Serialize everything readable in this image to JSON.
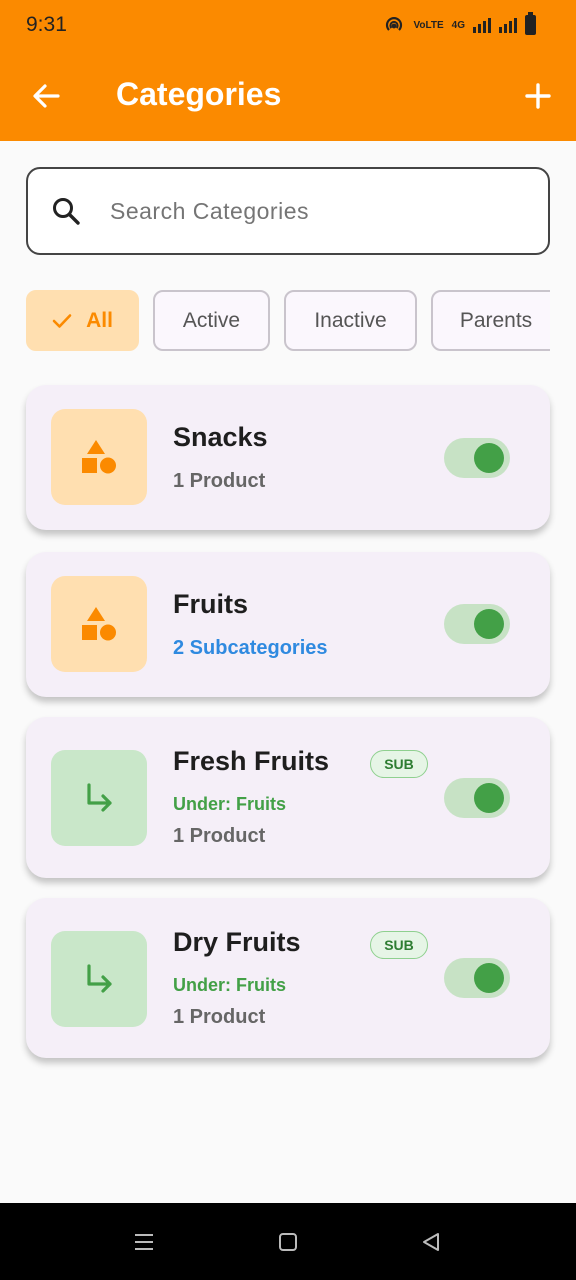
{
  "status_bar": {
    "time": "9:31",
    "network_label": "VoLTE",
    "network_sub": "4G"
  },
  "header": {
    "title": "Categories"
  },
  "search": {
    "placeholder": "Search Categories"
  },
  "filters": [
    {
      "label": "All",
      "selected": true
    },
    {
      "label": "Active",
      "selected": false
    },
    {
      "label": "Inactive",
      "selected": false
    },
    {
      "label": "Parents",
      "selected": false
    }
  ],
  "categories": [
    {
      "name": "Snacks",
      "detail": "1 Product",
      "active": true,
      "icon": "shapes-icon"
    },
    {
      "name": "Fruits",
      "detail": "2 Subcategories",
      "active": true,
      "icon": "shapes-icon"
    },
    {
      "name": "Fresh Fruits",
      "badge": "SUB",
      "parent": "Under: Fruits",
      "detail": "1 Product",
      "active": true,
      "icon": "subdirectory-arrow-icon"
    },
    {
      "name": "Dry Fruits",
      "badge": "SUB",
      "parent": "Under: Fruits",
      "detail": "1 Product",
      "active": true,
      "icon": "subdirectory-arrow-icon"
    }
  ],
  "colors": {
    "primary": "#fb8a00",
    "success": "#43a047",
    "link": "#2f8ae0"
  }
}
